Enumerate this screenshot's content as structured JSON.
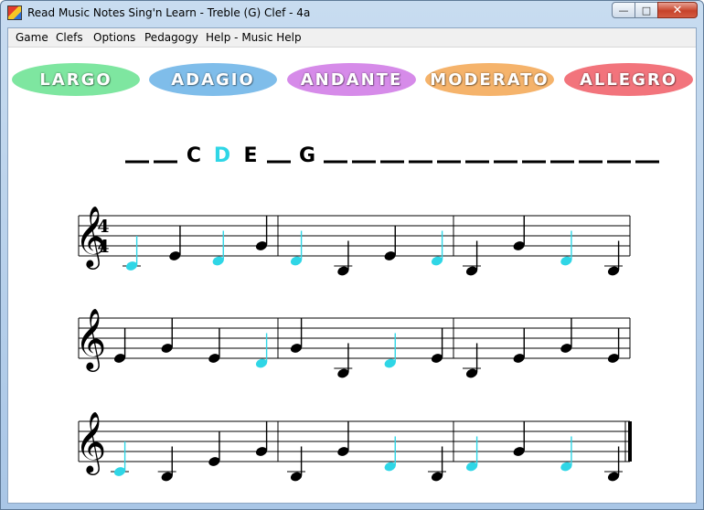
{
  "window": {
    "title": "Read Music Notes Sing'n Learn - Treble (G) Clef - 4a",
    "minimize_icon": "minimize-icon",
    "maximize_icon": "maximize-icon",
    "close_icon": "close-icon"
  },
  "menu": [
    {
      "label": "Game"
    },
    {
      "label": "Clefs"
    },
    {
      "label": "Options"
    },
    {
      "label": "Pedagogy"
    },
    {
      "label": "Help - Music Help"
    }
  ],
  "tempo_buttons": [
    {
      "label": "LARGO",
      "color": "#7ee6a0"
    },
    {
      "label": "ADAGIO",
      "color": "#7fbdea"
    },
    {
      "label": "ANDANTE",
      "color": "#d68be9"
    },
    {
      "label": "MODERATO",
      "color": "#f5b36b"
    },
    {
      "label": "ALLEGRO",
      "color": "#f2747c"
    }
  ],
  "answer": {
    "slots": [
      "",
      "",
      "C",
      "D",
      "E",
      "",
      "G",
      "",
      "",
      "",
      "",
      "",
      "",
      "",
      "",
      "",
      "",
      "",
      ""
    ],
    "highlight_index": 3,
    "highlight_color": "#2fd6e6"
  },
  "colors": {
    "note_highlight": "#2fd6e6",
    "note_normal": "#000000"
  },
  "time_signature": {
    "top": "4",
    "bottom": "4"
  },
  "staves": [
    {
      "measures": [
        [
          {
            "pitch": "C4",
            "highlight": true
          },
          {
            "pitch": "E4",
            "highlight": false
          },
          {
            "pitch": "D4",
            "highlight": true
          },
          {
            "pitch": "G4",
            "highlight": false
          }
        ],
        [
          {
            "pitch": "D4",
            "highlight": true
          },
          {
            "pitch": "B3",
            "highlight": false
          },
          {
            "pitch": "E4",
            "highlight": false
          },
          {
            "pitch": "D4",
            "highlight": true
          }
        ],
        [
          {
            "pitch": "B3",
            "highlight": false
          },
          {
            "pitch": "G4",
            "highlight": false
          },
          {
            "pitch": "D4",
            "highlight": true
          },
          {
            "pitch": "B3",
            "highlight": false
          }
        ]
      ]
    },
    {
      "measures": [
        [
          {
            "pitch": "E4",
            "highlight": false
          },
          {
            "pitch": "G4",
            "highlight": false
          },
          {
            "pitch": "E4",
            "highlight": false
          },
          {
            "pitch": "D4",
            "highlight": true
          }
        ],
        [
          {
            "pitch": "G4",
            "highlight": false
          },
          {
            "pitch": "B3",
            "highlight": false
          },
          {
            "pitch": "D4",
            "highlight": true
          },
          {
            "pitch": "E4",
            "highlight": false
          }
        ],
        [
          {
            "pitch": "B3",
            "highlight": false
          },
          {
            "pitch": "E4",
            "highlight": false
          },
          {
            "pitch": "G4",
            "highlight": false
          },
          {
            "pitch": "E4",
            "highlight": false
          }
        ]
      ]
    },
    {
      "measures": [
        [
          {
            "pitch": "C4",
            "highlight": true
          },
          {
            "pitch": "B3",
            "highlight": false
          },
          {
            "pitch": "E4",
            "highlight": false
          },
          {
            "pitch": "G4",
            "highlight": false
          }
        ],
        [
          {
            "pitch": "B3",
            "highlight": false
          },
          {
            "pitch": "G4",
            "highlight": false
          },
          {
            "pitch": "D4",
            "highlight": true
          },
          {
            "pitch": "B3",
            "highlight": false
          }
        ],
        [
          {
            "pitch": "D4",
            "highlight": true
          },
          {
            "pitch": "G4",
            "highlight": false
          },
          {
            "pitch": "D4",
            "highlight": true
          },
          {
            "pitch": "B3",
            "highlight": false
          }
        ]
      ]
    }
  ]
}
